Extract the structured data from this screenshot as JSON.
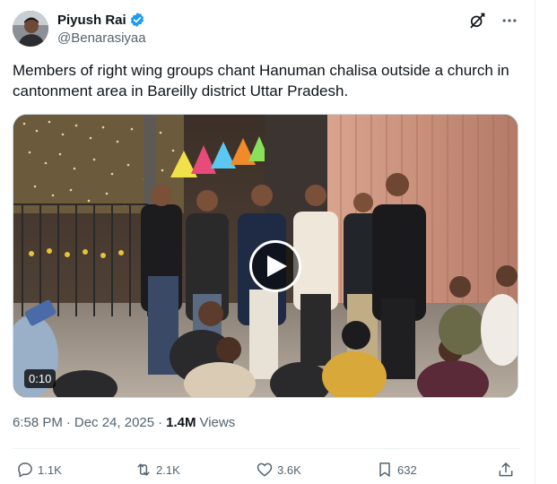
{
  "author": {
    "display_name": "Piyush Rai",
    "handle": "@Benarasiyaa",
    "verified": true
  },
  "header_icons": [
    "grok-icon",
    "more-icon"
  ],
  "tweet": {
    "text": "Members of right wing groups chant Hanuman chalisa outside a church in cantonment area in Bareilly district Uttar Pradesh."
  },
  "media": {
    "type": "video",
    "duration": "0:10",
    "play_icon": "play-icon"
  },
  "meta": {
    "time": "6:58 PM",
    "separator": "·",
    "date": "Dec 24, 2025",
    "views_count": "1.4M",
    "views_label": "Views"
  },
  "actions": {
    "reply": {
      "icon": "reply-icon",
      "count": "1.1K"
    },
    "retweet": {
      "icon": "retweet-icon",
      "count": "2.1K"
    },
    "like": {
      "icon": "heart-icon",
      "count": "3.6K"
    },
    "bookmark": {
      "icon": "bookmark-icon",
      "count": "632"
    },
    "share": {
      "icon": "share-icon"
    }
  },
  "colors": {
    "text_primary": "#0f1419",
    "text_secondary": "#536471",
    "verified_blue": "#1d9bf0",
    "divider": "#eff3f4"
  }
}
